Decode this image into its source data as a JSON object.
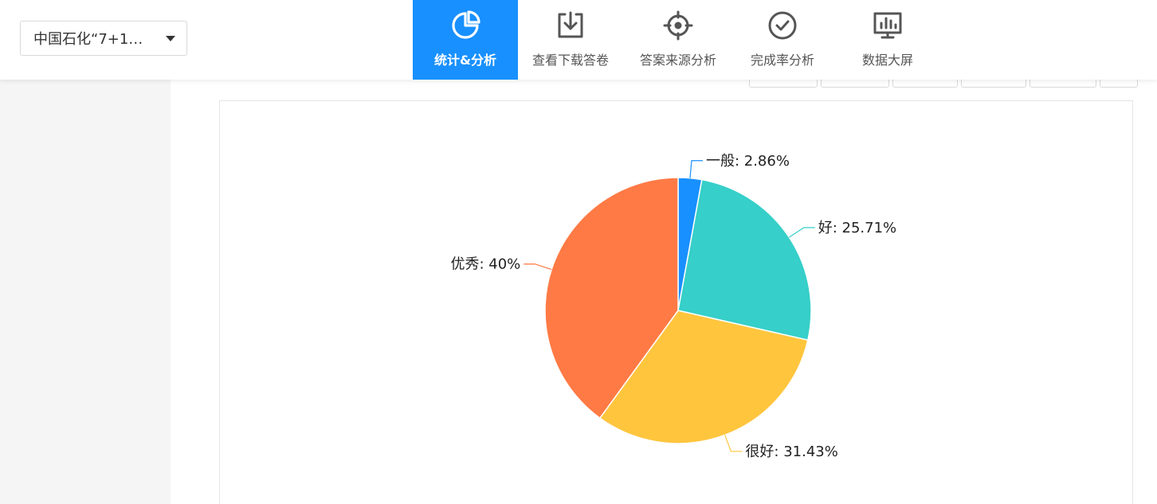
{
  "header": {
    "project_select": {
      "value": "中国石化“7+1…"
    },
    "nav": [
      {
        "label": "统计&分析",
        "icon": "pie-chart-icon",
        "active": true
      },
      {
        "label": "查看下载答卷",
        "icon": "download-icon",
        "active": false
      },
      {
        "label": "答案来源分析",
        "icon": "crosshair-icon",
        "active": false
      },
      {
        "label": "完成率分析",
        "icon": "check-circle-icon",
        "active": false
      },
      {
        "label": "数据大屏",
        "icon": "monitor-chart-icon",
        "active": false
      }
    ]
  },
  "colors": {
    "accent": "#1890ff",
    "nav_text": "#555555",
    "rail_bg": "#f5f5f5"
  },
  "chart_data": {
    "type": "pie",
    "categories": [
      "一般",
      "好",
      "很好",
      "优秀"
    ],
    "values": [
      2.86,
      25.71,
      31.43,
      40
    ],
    "labels": [
      "一般: 2.86%",
      "好: 25.71%",
      "很好: 31.43%",
      "优秀: 40%"
    ],
    "colors": [
      "#1890ff",
      "#36cfc9",
      "#ffc53d",
      "#ff7a45"
    ],
    "title": "",
    "legend": "none"
  }
}
